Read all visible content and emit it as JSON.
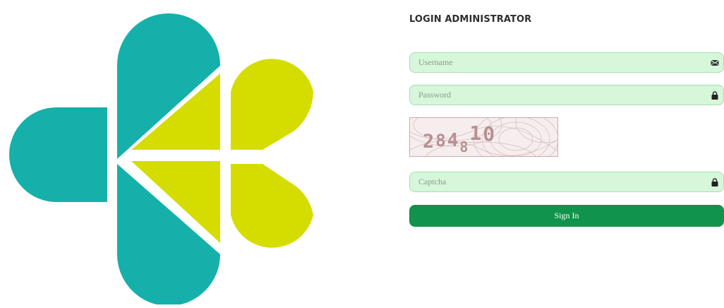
{
  "login": {
    "title": "LOGIN ADMINISTRATOR",
    "username": {
      "placeholder": "Username",
      "value": "",
      "icon": "envelope-icon"
    },
    "password": {
      "placeholder": "Password",
      "value": "",
      "icon": "lock-icon"
    },
    "captcha_image": {
      "text": "284810"
    },
    "captcha": {
      "placeholder": "Captcha",
      "value": "",
      "icon": "lock-icon"
    },
    "signin_label": "Sign In"
  },
  "colors": {
    "logo_teal": "#16b0aa",
    "logo_lime": "#d5dd00",
    "field_bg": "#d6f7da",
    "field_border": "#a9dcb0",
    "button_bg": "#10934a",
    "button_text": "#ffffff",
    "title_text": "#2e2e2e",
    "captcha_text": "#b88f93"
  }
}
